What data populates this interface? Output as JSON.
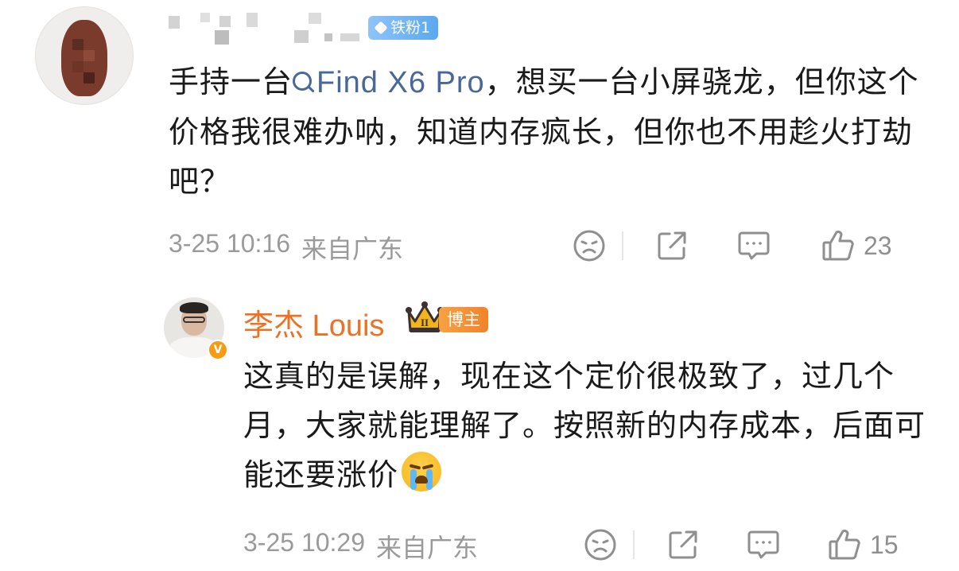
{
  "comments": [
    {
      "fan_badge": "铁粉1",
      "text_before": "手持一台",
      "link_text": "Find X6 Pro",
      "text_after": "，想买一台小屏骁龙，但你这个价格我很难办呐，知道内存疯长，但你也不用趁火打劫吧？",
      "date": "3-25 10:16",
      "location": "来自广东",
      "like_count": "23"
    },
    {
      "author": "李杰 Louis",
      "author_badge": "博主",
      "crown_level": "II",
      "verified_mark": "V",
      "text": "这真的是误解，现在这个定价很极致了，过几个月，大家就能理解了。按照新的内存成本，后面可能还要涨价",
      "date": "3-25 10:29",
      "location": "来自广东",
      "like_count": "15"
    }
  ],
  "icons": {
    "dislike": "sad-face-icon",
    "share": "share-icon",
    "reply": "comment-bubble-icon",
    "like": "thumbs-up-icon",
    "link": "search-link-icon",
    "emoji": "crying-face-emoji"
  },
  "colors": {
    "link": "#49679a",
    "author_name": "#eb7225",
    "meta_text": "#9a9a9a",
    "fan_badge": "#5aa8f0",
    "host_badge": "#f1832b"
  }
}
